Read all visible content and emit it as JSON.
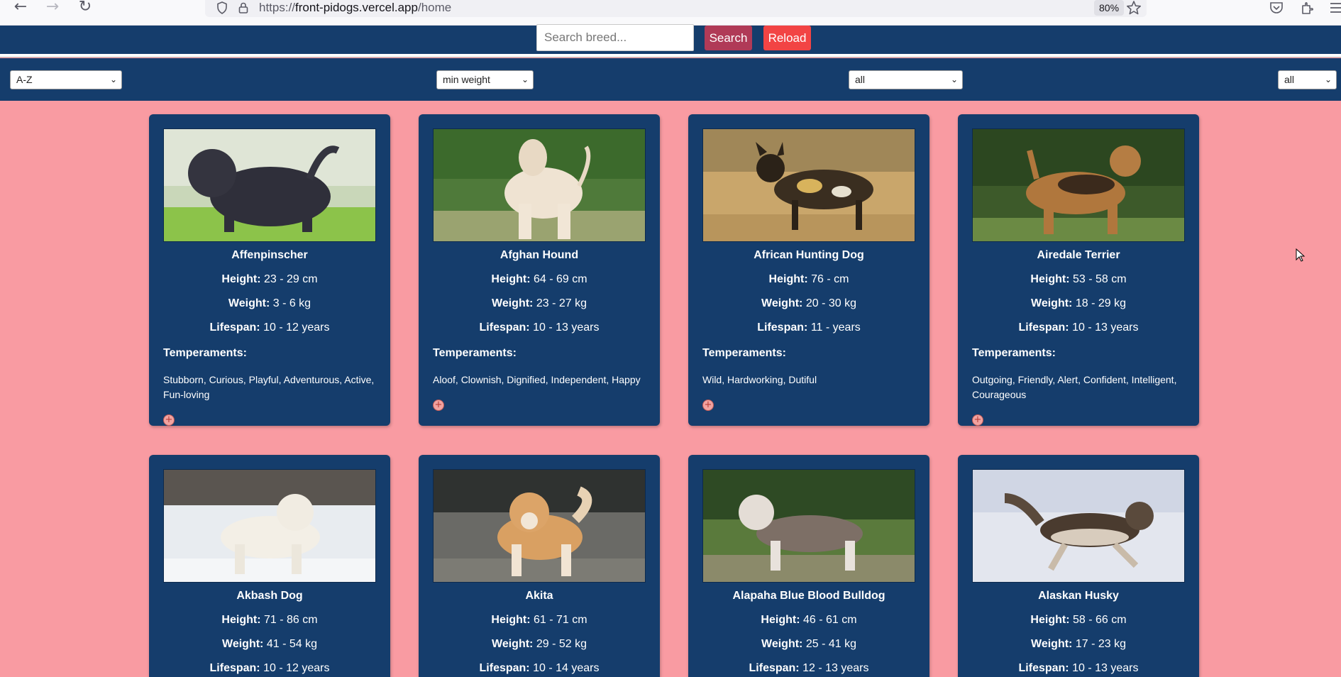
{
  "browser": {
    "url_prefix": "https://",
    "url_host": "front-pidogs.vercel.app",
    "url_path": "/home",
    "zoom": "80%"
  },
  "header": {
    "search_placeholder": "Search breed...",
    "search_label": "Search",
    "reload_label": "Reload"
  },
  "filters": {
    "sort": "A-Z",
    "weight": "min weight",
    "temperament": "all",
    "origin": "all"
  },
  "labels": {
    "height": "Height:",
    "weight": "Weight:",
    "lifespan": "Lifespan:",
    "temperaments": "Temperaments:"
  },
  "cards": [
    {
      "name": "Affenpinscher",
      "height": "23 - 29 cm",
      "weight": "3 - 6 kg",
      "lifespan": "10 - 12 years",
      "temperaments": "Stubborn, Curious, Playful, Adventurous, Active, Fun-loving"
    },
    {
      "name": "Afghan Hound",
      "height": "64 - 69 cm",
      "weight": "23 - 27 kg",
      "lifespan": "10 - 13 years",
      "temperaments": "Aloof, Clownish, Dignified, Independent, Happy"
    },
    {
      "name": "African Hunting Dog",
      "height": "76 - cm",
      "weight": "20 - 30 kg",
      "lifespan": "11 - years",
      "temperaments": "Wild, Hardworking, Dutiful"
    },
    {
      "name": "Airedale Terrier",
      "height": "53 - 58 cm",
      "weight": "18 - 29 kg",
      "lifespan": "10 - 13 years",
      "temperaments": "Outgoing, Friendly, Alert, Confident, Intelligent, Courageous"
    },
    {
      "name": "Akbash Dog",
      "height": "71 - 86 cm",
      "weight": "41 - 54 kg",
      "lifespan": "10 - 12 years",
      "temperaments": ""
    },
    {
      "name": "Akita",
      "height": "61 - 71 cm",
      "weight": "29 - 52 kg",
      "lifespan": "10 - 14 years",
      "temperaments": ""
    },
    {
      "name": "Alapaha Blue Blood Bulldog",
      "height": "46 - 61 cm",
      "weight": "25 - 41 kg",
      "lifespan": "12 - 13 years",
      "temperaments": ""
    },
    {
      "name": "Alaskan Husky",
      "height": "58 - 66 cm",
      "weight": "17 - 23 kg",
      "lifespan": "10 - 13 years",
      "temperaments": ""
    }
  ],
  "add_glyph": "+",
  "colors": {
    "page_bg": "#f99ba2",
    "navy": "#153d6c",
    "search_button": "#b03a57",
    "reload_button": "#f24444"
  }
}
